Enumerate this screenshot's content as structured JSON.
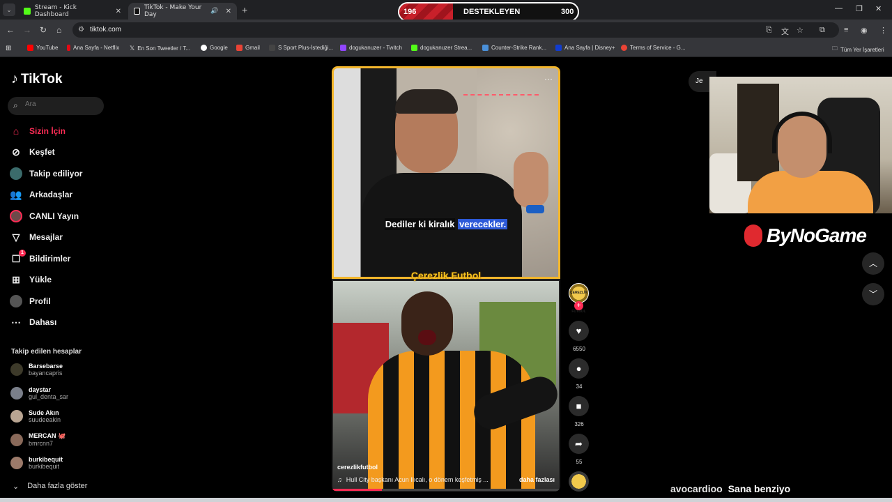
{
  "browser": {
    "tabs": [
      {
        "title": "Stream - Kick Dashboard",
        "color": "#53fc18"
      },
      {
        "title": "TikTok - Make Your Day",
        "color": "#ffffff"
      }
    ],
    "url": "tiktok.com",
    "bookmarks": [
      {
        "label": "YouTube",
        "color": "#ff0000"
      },
      {
        "label": "Ana Sayfa - Netflix",
        "color": "#e50914"
      },
      {
        "label": "En Son Tweetler / T...",
        "color": "#ffffff"
      },
      {
        "label": "Google",
        "color": "#4285f4"
      },
      {
        "label": "Gmail",
        "color": "#ea4335"
      },
      {
        "label": "S Sport Plus-İstediği...",
        "color": "#333333"
      },
      {
        "label": "dogukanuzer - Twitch",
        "color": "#9146ff"
      },
      {
        "label": "dogukanuzer Strea...",
        "color": "#53fc18"
      },
      {
        "label": "Counter-Strike Rank...",
        "color": "#4a90d9"
      },
      {
        "label": "Ana Sayfa | Disney+",
        "color": "#113ccf"
      },
      {
        "label": "Terms of Service - G...",
        "color": "#ea4335"
      }
    ],
    "all_bookmarks": "Tüm Yer İşaretleri"
  },
  "support_bar": {
    "left": "196",
    "label": "DESTEKLEYEN",
    "right": "300",
    "fill_fraction": 0.3
  },
  "tiktok": {
    "logo": "TikTok",
    "search_placeholder": "Ara",
    "nav": [
      {
        "label": "Sizin İçin",
        "icon": "home-icon"
      },
      {
        "label": "Keşfet",
        "icon": "compass-icon"
      },
      {
        "label": "Takip ediliyor",
        "icon": "following-icon"
      },
      {
        "label": "Arkadaşlar",
        "icon": "friends-icon"
      },
      {
        "label": "CANLI Yayın",
        "icon": "live-icon"
      },
      {
        "label": "Mesajlar",
        "icon": "message-icon"
      },
      {
        "label": "Bildirimler",
        "icon": "bell-icon",
        "badge": "1"
      },
      {
        "label": "Yükle",
        "icon": "upload-icon"
      },
      {
        "label": "Profil",
        "icon": "profile-icon"
      },
      {
        "label": "Dahası",
        "icon": "more-icon"
      }
    ],
    "following_title": "Takip edilen hesaplar",
    "accounts": [
      {
        "name": "Barsebarse",
        "handle": "bayancapris"
      },
      {
        "name": "daystar",
        "handle": "gul_denta_sar"
      },
      {
        "name": "Sude Akın",
        "handle": "suudeeakin"
      },
      {
        "name": "MERCAN 🐙",
        "handle": "bmrcnn7"
      },
      {
        "name": "burkibequit",
        "handle": "burkibequit"
      }
    ],
    "show_more": "Daha fazla göster"
  },
  "video": {
    "subtitle_pre": "Dediler ki kiralık",
    "subtitle_hl": "verecekler.",
    "brand_tag": "Çerezlik Futbol",
    "username": "cerezlikfutbol",
    "description": "Hull City başkanı Acun Ilıcalı, o dönem keşfetmiş ...",
    "more": "daha fazlası",
    "progress_fraction": 0.22,
    "avatar_text": "ÇEREZLİK FUTBOL",
    "likes": "6550",
    "comments": "34",
    "saves": "326",
    "shares": "55"
  },
  "right": {
    "pill": "Je",
    "sponsor": "ByNoGame",
    "chat_user": "avocardioo",
    "chat_message": "Sana benziyo"
  },
  "colors": {
    "accent": "#fe2c55",
    "gold": "#f3b62c"
  }
}
